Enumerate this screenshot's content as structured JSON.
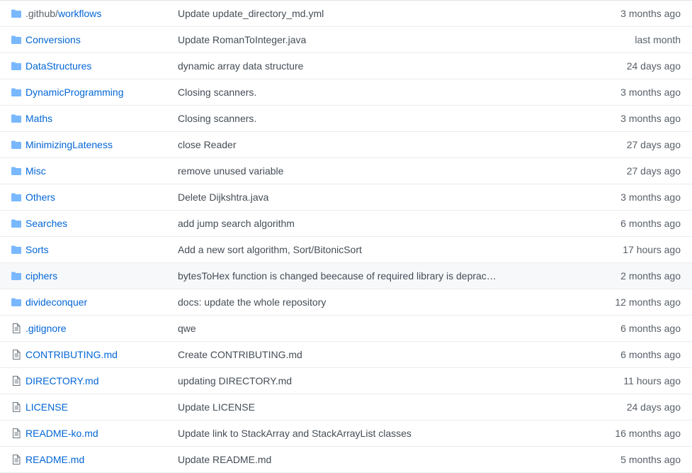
{
  "colors": {
    "link": "#0366d6",
    "muted": "#586069",
    "message": "#444d56",
    "folder_icon": "#79b8ff",
    "file_icon": "#6a737d",
    "border": "#eaecef",
    "highlight_row": "#f6f8fa"
  },
  "files": [
    {
      "icon": "folder-icon",
      "prefix": ".github/",
      "name": "workflows",
      "message": "Update update_directory_md.yml",
      "age": "3 months ago"
    },
    {
      "icon": "folder-icon",
      "prefix": "",
      "name": "Conversions",
      "message": "Update RomanToInteger.java",
      "age": "last month"
    },
    {
      "icon": "folder-icon",
      "prefix": "",
      "name": "DataStructures",
      "message": "dynamic array data structure",
      "age": "24 days ago"
    },
    {
      "icon": "folder-icon",
      "prefix": "",
      "name": "DynamicProgramming",
      "message": "Closing scanners.",
      "age": "3 months ago"
    },
    {
      "icon": "folder-icon",
      "prefix": "",
      "name": "Maths",
      "message": "Closing scanners.",
      "age": "3 months ago"
    },
    {
      "icon": "folder-icon",
      "prefix": "",
      "name": "MinimizingLateness",
      "message": "close Reader",
      "age": "27 days ago"
    },
    {
      "icon": "folder-icon",
      "prefix": "",
      "name": "Misc",
      "message": "remove unused variable",
      "age": "27 days ago"
    },
    {
      "icon": "folder-icon",
      "prefix": "",
      "name": "Others",
      "message": "Delete Dijkshtra.java",
      "age": "3 months ago"
    },
    {
      "icon": "folder-icon",
      "prefix": "",
      "name": "Searches",
      "message": "add jump search algorithm",
      "age": "6 months ago"
    },
    {
      "icon": "folder-icon",
      "prefix": "",
      "name": "Sorts",
      "message": "Add a new sort algorithm, Sort/BitonicSort",
      "age": "17 hours ago"
    },
    {
      "icon": "folder-icon",
      "prefix": "",
      "name": "ciphers",
      "message": "bytesToHex function is changed beecause of required library is deprac…",
      "age": "2 months ago",
      "highlight": true
    },
    {
      "icon": "folder-icon",
      "prefix": "",
      "name": "divideconquer",
      "message": "docs: update the whole repository",
      "age": "12 months ago"
    },
    {
      "icon": "file-icon",
      "prefix": "",
      "name": ".gitignore",
      "message": "qwe",
      "age": "6 months ago"
    },
    {
      "icon": "file-icon",
      "prefix": "",
      "name": "CONTRIBUTING.md",
      "message": "Create CONTRIBUTING.md",
      "age": "6 months ago"
    },
    {
      "icon": "file-icon",
      "prefix": "",
      "name": "DIRECTORY.md",
      "message": "updating DIRECTORY.md",
      "age": "11 hours ago"
    },
    {
      "icon": "file-icon",
      "prefix": "",
      "name": "LICENSE",
      "message": "Update LICENSE",
      "age": "24 days ago"
    },
    {
      "icon": "file-icon",
      "prefix": "",
      "name": "README-ko.md",
      "message": "Update link to StackArray and StackArrayList classes",
      "age": "16 months ago"
    },
    {
      "icon": "file-icon",
      "prefix": "",
      "name": "README.md",
      "message": "Update README.md",
      "age": "5 months ago"
    }
  ]
}
